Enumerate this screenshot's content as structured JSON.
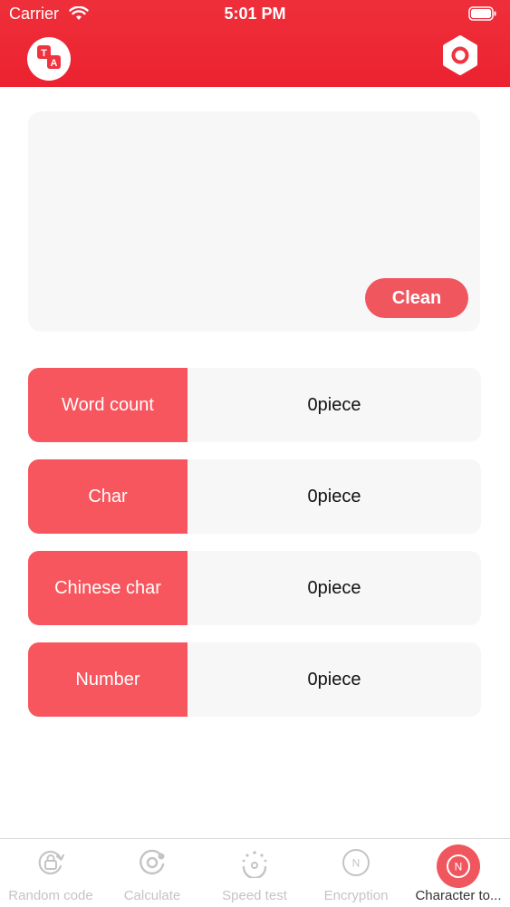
{
  "status": {
    "carrier": "Carrier",
    "time": "5:01 PM"
  },
  "header": {
    "left_icon": "translate-icon",
    "right_icon": "settings-icon"
  },
  "input": {
    "value": "",
    "clean_label": "Clean"
  },
  "stats": [
    {
      "label": "Word count",
      "value": "0piece"
    },
    {
      "label": "Char",
      "value": "0piece"
    },
    {
      "label": "Chinese char",
      "value": "0piece"
    },
    {
      "label": "Number",
      "value": "0piece"
    }
  ],
  "tabs": [
    {
      "label": "Random code",
      "icon": "random-code-icon"
    },
    {
      "label": "Calculate",
      "icon": "calculate-icon"
    },
    {
      "label": "Speed test",
      "icon": "speed-test-icon"
    },
    {
      "label": "Encryption",
      "icon": "encryption-icon"
    },
    {
      "label": "Character to...",
      "icon": "character-count-icon",
      "active": true
    }
  ],
  "colors": {
    "accent": "#ee2630",
    "button": "#f0565e",
    "panel": "#f7f7f8",
    "inactive_tab": "#c4c4c4"
  }
}
